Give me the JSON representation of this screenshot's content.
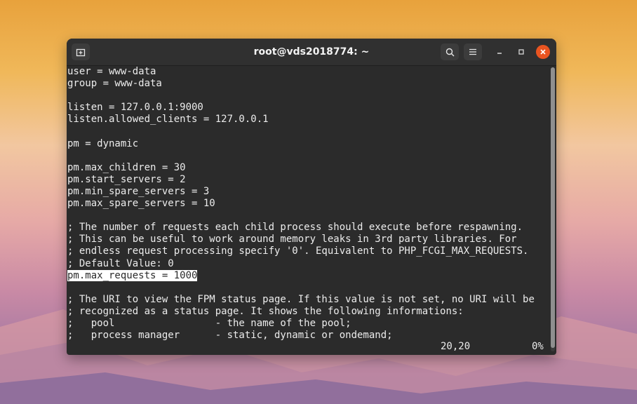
{
  "window": {
    "title": "root@vds2018774: ~"
  },
  "icons": {
    "new_tab": "new-tab-icon",
    "search": "search-icon",
    "menu": "hamburger-menu-icon",
    "minimize": "minimize-icon",
    "maximize": "maximize-icon",
    "close": "close-icon"
  },
  "colors": {
    "close_button": "#e95420",
    "terminal_bg": "#2b2b2b"
  },
  "terminal": {
    "lines": [
      "user = www-data",
      "group = www-data",
      "",
      "listen = 127.0.0.1:9000",
      "listen.allowed_clients = 127.0.0.1",
      "",
      "pm = dynamic",
      "",
      "pm.max_children = 30",
      "pm.start_servers = 2",
      "pm.min_spare_servers = 3",
      "pm.max_spare_servers = 10",
      "",
      "; The number of requests each child process should execute before respawning.",
      "; This can be useful to work around memory leaks in 3rd party libraries. For",
      "; endless request processing specify '0'. Equivalent to PHP_FCGI_MAX_REQUESTS.",
      "; Default Value: 0",
      "pm.max_requests = 1000",
      "",
      "; The URI to view the FPM status page. If this value is not set, no URI will be",
      "; recognized as a status page. It shows the following informations:",
      ";   pool                 - the name of the pool;",
      ";   process manager      - static, dynamic or ondemand;"
    ],
    "highlighted_line_index": 17,
    "status": {
      "position": "20,20",
      "percent": "0%"
    }
  }
}
